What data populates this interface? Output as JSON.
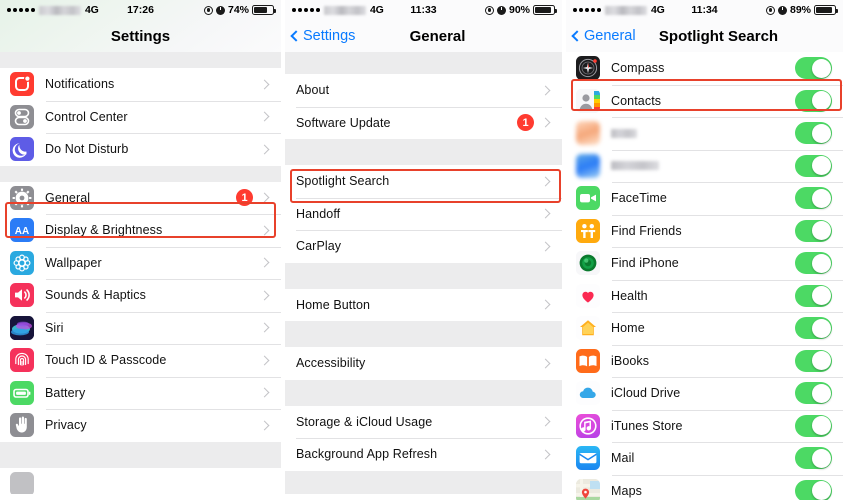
{
  "panels": [
    {
      "id": "settings",
      "status": {
        "network": "4G",
        "time": "17:26",
        "battery": "74%"
      },
      "nav": {
        "title": "Settings",
        "back": null
      },
      "sections": [
        {
          "items": [
            {
              "label": "Notifications",
              "icon": "notifications-icon",
              "accessory": "chevron"
            },
            {
              "label": "Control Center",
              "icon": "control-center-icon",
              "accessory": "chevron"
            },
            {
              "label": "Do Not Disturb",
              "icon": "do-not-disturb-icon",
              "accessory": "chevron"
            }
          ]
        },
        {
          "items": [
            {
              "label": "General",
              "icon": "general-icon",
              "accessory": "chevron",
              "badge": "1",
              "highlighted": true
            },
            {
              "label": "Display & Brightness",
              "icon": "display-brightness-icon",
              "accessory": "chevron"
            },
            {
              "label": "Wallpaper",
              "icon": "wallpaper-icon",
              "accessory": "chevron"
            },
            {
              "label": "Sounds & Haptics",
              "icon": "sounds-haptics-icon",
              "accessory": "chevron"
            },
            {
              "label": "Siri",
              "icon": "siri-icon",
              "accessory": "chevron"
            },
            {
              "label": "Touch ID & Passcode",
              "icon": "touch-id-passcode-icon",
              "accessory": "chevron"
            },
            {
              "label": "Battery",
              "icon": "battery-icon",
              "accessory": "chevron"
            },
            {
              "label": "Privacy",
              "icon": "privacy-icon",
              "accessory": "chevron"
            }
          ]
        }
      ]
    },
    {
      "id": "general",
      "status": {
        "network": "4G",
        "time": "11:33",
        "battery": "90%"
      },
      "nav": {
        "title": "General",
        "back": "Settings"
      },
      "sections": [
        {
          "items": [
            {
              "label": "About",
              "accessory": "chevron"
            },
            {
              "label": "Software Update",
              "accessory": "chevron",
              "badge": "1"
            }
          ]
        },
        {
          "items": [
            {
              "label": "Spotlight Search",
              "accessory": "chevron",
              "highlighted": true
            },
            {
              "label": "Handoff",
              "accessory": "chevron"
            },
            {
              "label": "CarPlay",
              "accessory": "chevron"
            }
          ]
        },
        {
          "items": [
            {
              "label": "Home Button",
              "accessory": "chevron"
            }
          ]
        },
        {
          "items": [
            {
              "label": "Accessibility",
              "accessory": "chevron"
            }
          ]
        },
        {
          "items": [
            {
              "label": "Storage & iCloud Usage",
              "accessory": "chevron"
            },
            {
              "label": "Background App Refresh",
              "accessory": "chevron"
            }
          ]
        }
      ]
    },
    {
      "id": "spotlight-search",
      "status": {
        "network": "4G",
        "time": "11:34",
        "battery": "89%"
      },
      "nav": {
        "title": "Spotlight Search",
        "back": "General"
      },
      "sections": [
        {
          "items": [
            {
              "label": "Compass",
              "icon": "compass-icon",
              "toggle": true
            },
            {
              "label": "Contacts",
              "icon": "contacts-icon",
              "toggle": true,
              "highlighted": true
            },
            {
              "label": "",
              "icon": "blurred-icon-peach",
              "toggle": true,
              "blurred": true,
              "blur_width": 26
            },
            {
              "label": "",
              "icon": "blurred-icon-blue",
              "toggle": true,
              "blurred": true,
              "blur_width": 48
            },
            {
              "label": "FaceTime",
              "icon": "facetime-icon",
              "toggle": true
            },
            {
              "label": "Find Friends",
              "icon": "find-friends-icon",
              "toggle": true
            },
            {
              "label": "Find iPhone",
              "icon": "find-iphone-icon",
              "toggle": true
            },
            {
              "label": "Health",
              "icon": "health-icon",
              "toggle": true
            },
            {
              "label": "Home",
              "icon": "home-icon",
              "toggle": true
            },
            {
              "label": "iBooks",
              "icon": "ibooks-icon",
              "toggle": true
            },
            {
              "label": "iCloud Drive",
              "icon": "icloud-drive-icon",
              "toggle": true
            },
            {
              "label": "iTunes Store",
              "icon": "itunes-store-icon",
              "toggle": true
            },
            {
              "label": "Mail",
              "icon": "mail-icon",
              "toggle": true
            },
            {
              "label": "Maps",
              "icon": "maps-icon",
              "toggle": true
            }
          ]
        }
      ]
    }
  ],
  "colors": {
    "accent_blue": "#0a7bff",
    "badge_red": "#ff3b30",
    "toggle_green": "#4cd964",
    "highlight_red": "#e8412b",
    "separator": "#e2e2e4",
    "group_gap": "#ececed"
  }
}
